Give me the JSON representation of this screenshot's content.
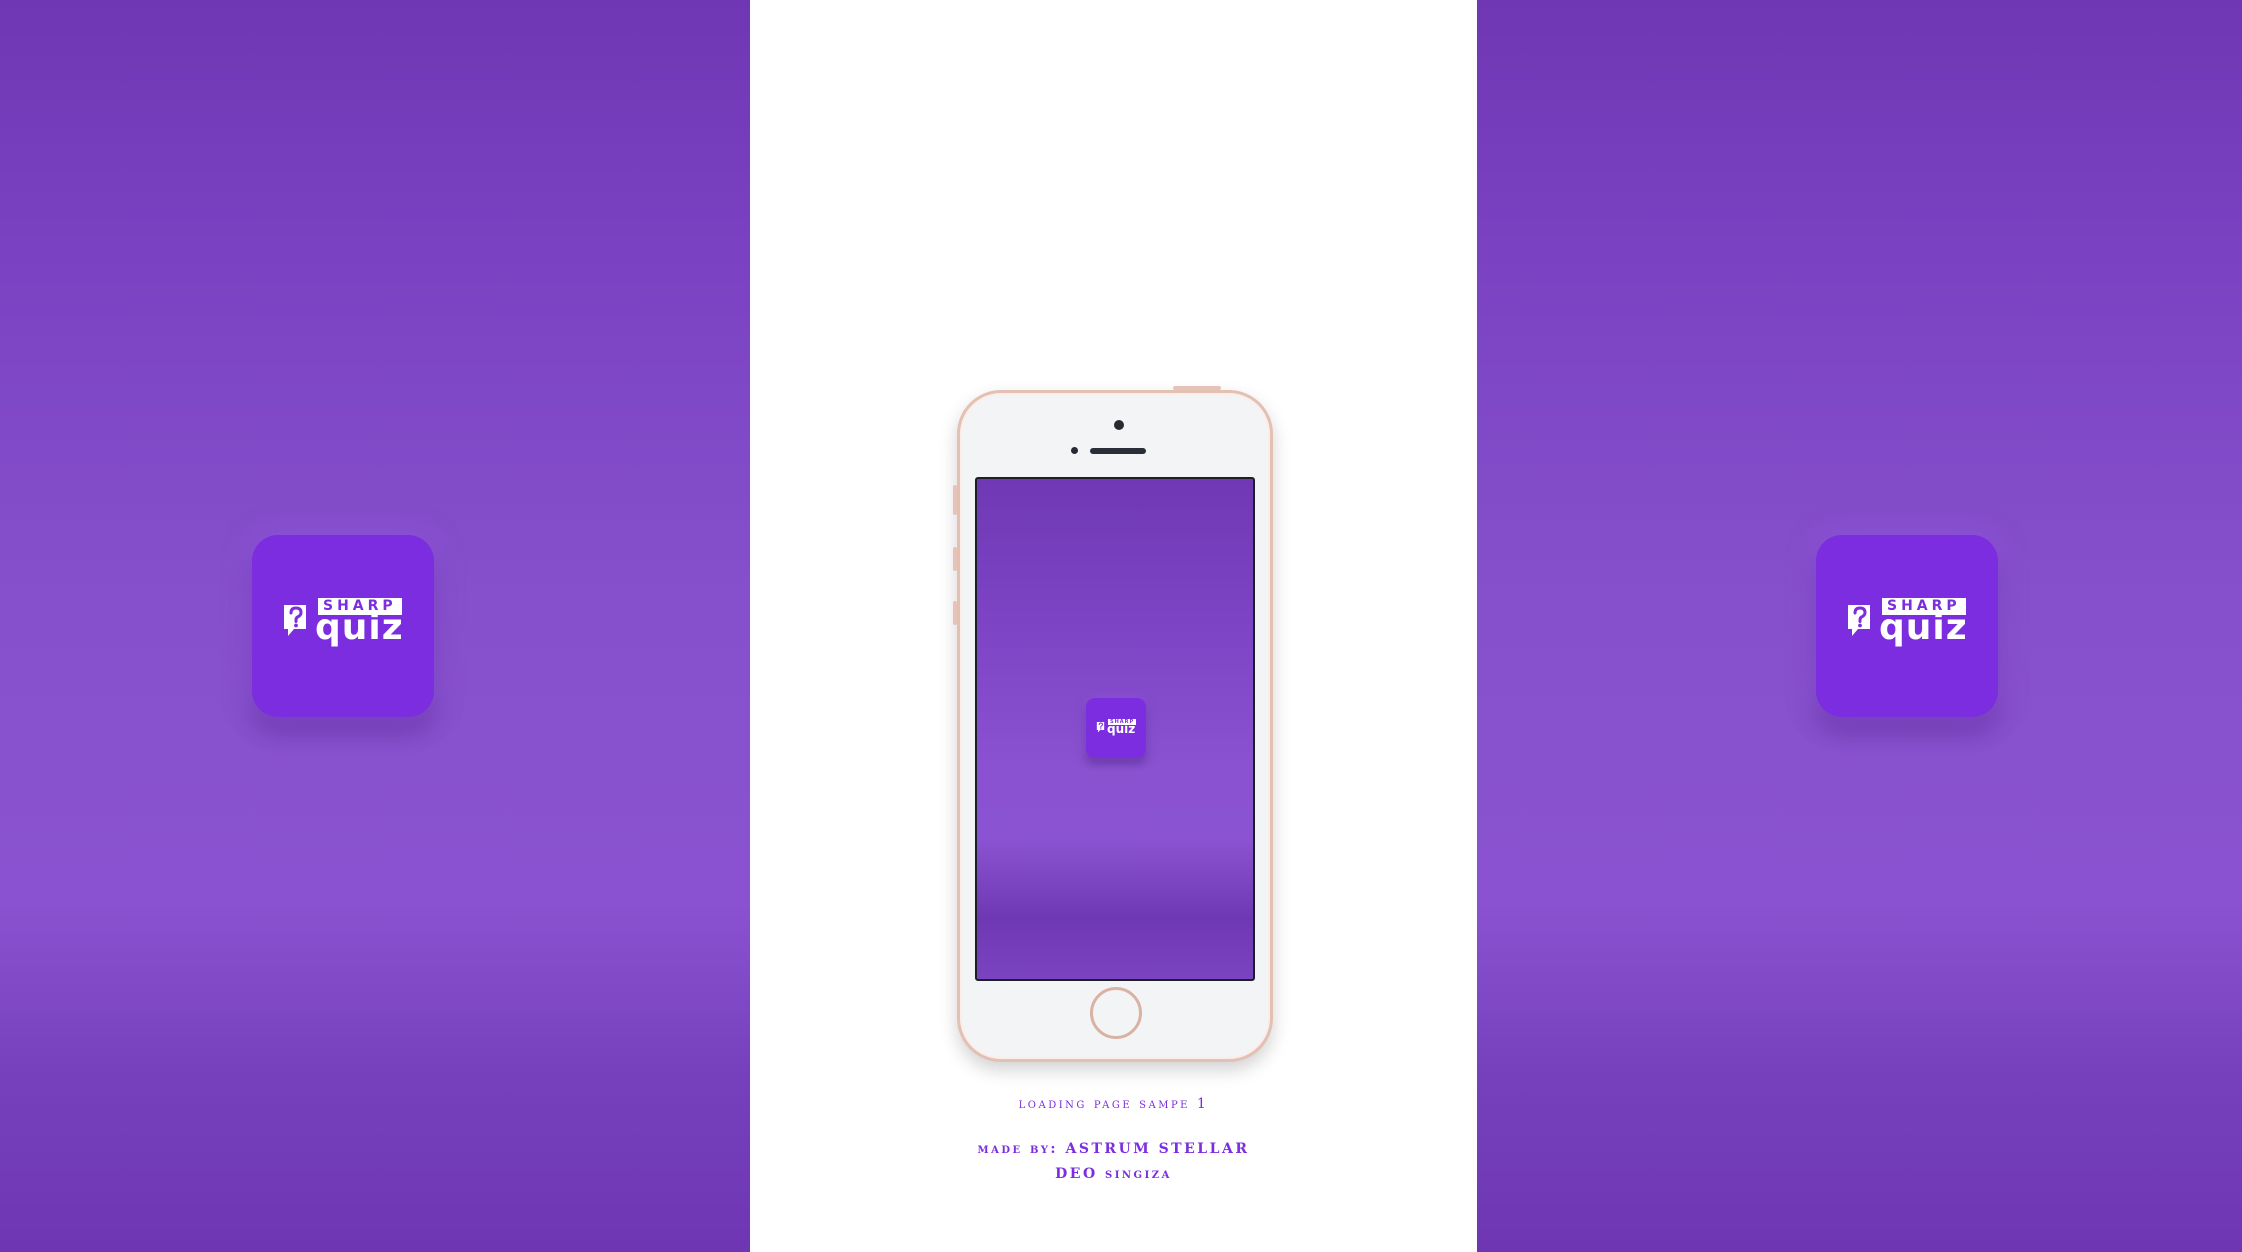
{
  "app": {
    "name_top": "SHARP",
    "name_main": "quiz",
    "colors": {
      "brand": "#7b2ddf",
      "background_purple": "#8650cc",
      "caption": "#7b2ddf",
      "phone_frame": "#e3c0b4"
    }
  },
  "icons": {
    "question_mark": "question-bubble-icon"
  },
  "captions": {
    "line1": "loading page sampe 1",
    "line2": "made by: ASTRUM STELLAR",
    "line3": "DEO singiza"
  }
}
